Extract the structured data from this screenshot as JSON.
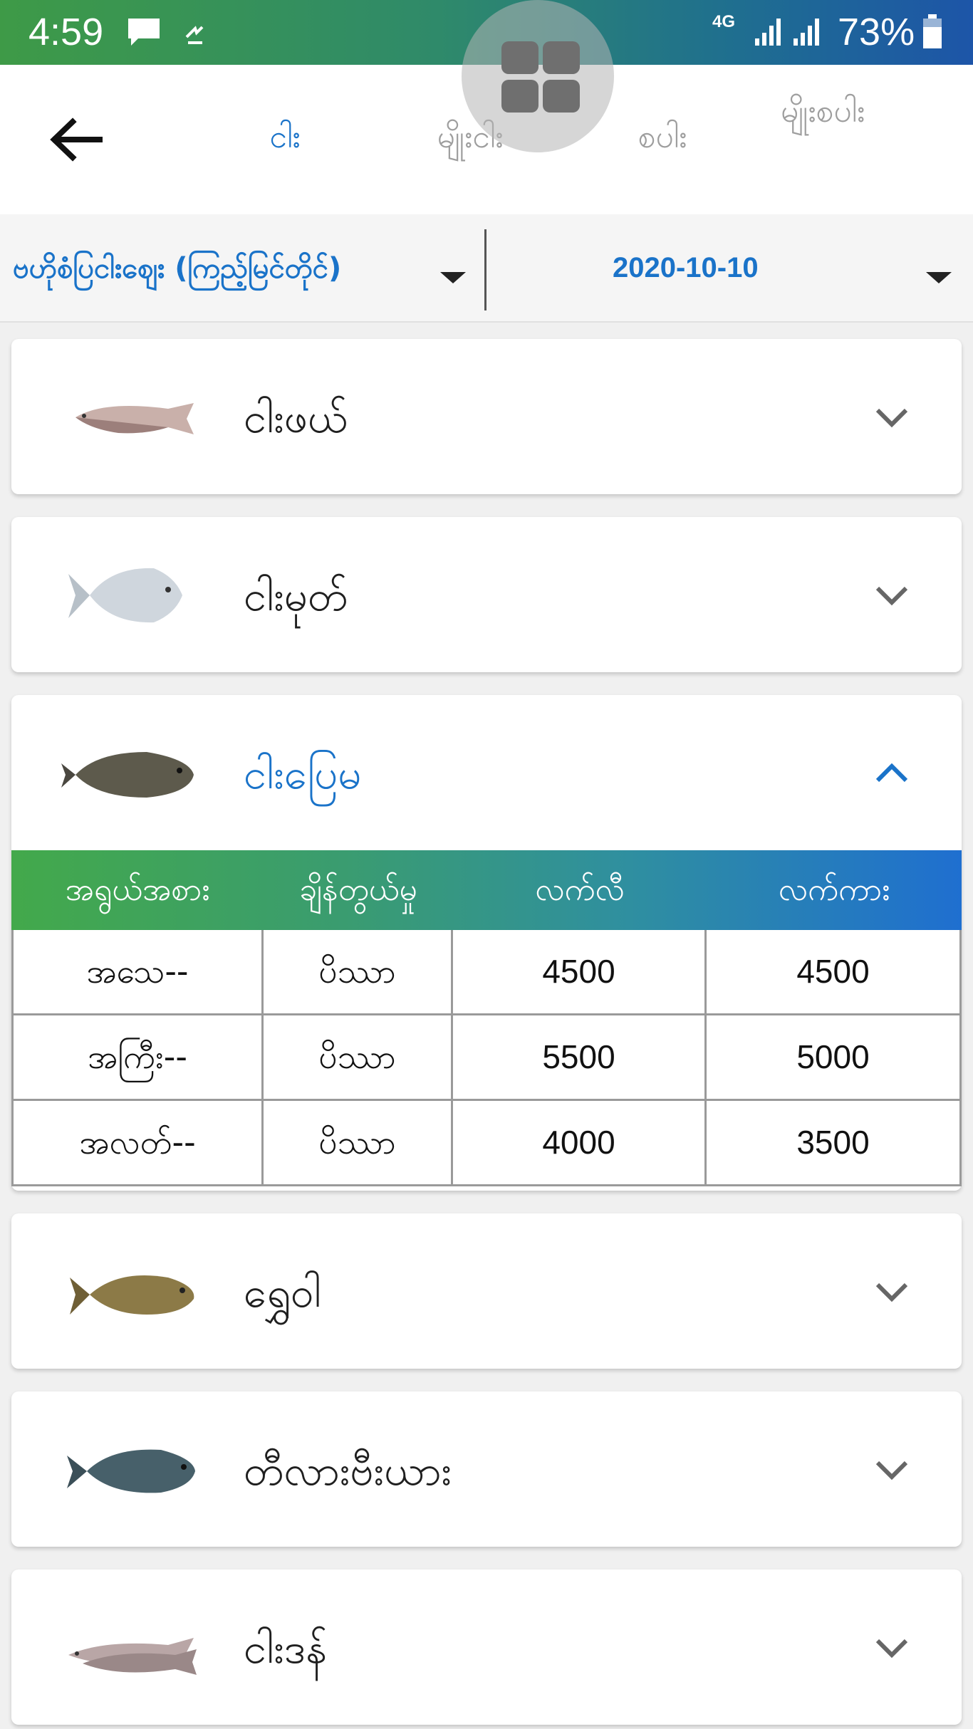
{
  "status_bar": {
    "time": "4:59",
    "network": "4G",
    "battery": "73%",
    "icons": [
      "message-icon",
      "sync-icon",
      "signal-icon",
      "signal-icon",
      "battery-icon"
    ]
  },
  "toolbar": {
    "tabs": [
      {
        "label": "ငါး",
        "active": true
      },
      {
        "label": "မျိုးငါး",
        "active": false
      },
      {
        "label": "စပါး",
        "active": false
      },
      {
        "label": "မျိုးစပါး",
        "active": false
      }
    ],
    "back_icon": "back-arrow-icon",
    "floating_icon": "grid-menu-icon"
  },
  "selectors": {
    "market": "ဗဟိုစံပြငါးဈေး (ကြည့်မြင်တိုင်)",
    "date": "2020-10-10"
  },
  "fish_list": [
    {
      "name": "ငါးဖယ်",
      "expanded": false
    },
    {
      "name": "ငါးမုတ်",
      "expanded": false
    },
    {
      "name": "ငါးပြေမ",
      "expanded": true
    },
    {
      "name": "ရွှေဝါ",
      "expanded": false
    },
    {
      "name": "တီလားဗီးယား",
      "expanded": false
    },
    {
      "name": "ငါးဒန်",
      "expanded": false
    }
  ],
  "price_table": {
    "headers": [
      "အရွယ်အစား",
      "ချိန်တွယ်မှု",
      "လက်လီ",
      "လက်ကား"
    ],
    "rows": [
      [
        "အသေ--",
        "ပိဿာ",
        "4500",
        "4500"
      ],
      [
        "အကြီး--",
        "ပိဿာ",
        "5500",
        "5000"
      ],
      [
        "အလတ်--",
        "ပိဿာ",
        "4000",
        "3500"
      ]
    ]
  },
  "colors": {
    "accent": "#1a73c9",
    "status_green": "#3e9a47",
    "status_blue": "#1d55a8",
    "inactive_tab": "#9e9e9e"
  }
}
